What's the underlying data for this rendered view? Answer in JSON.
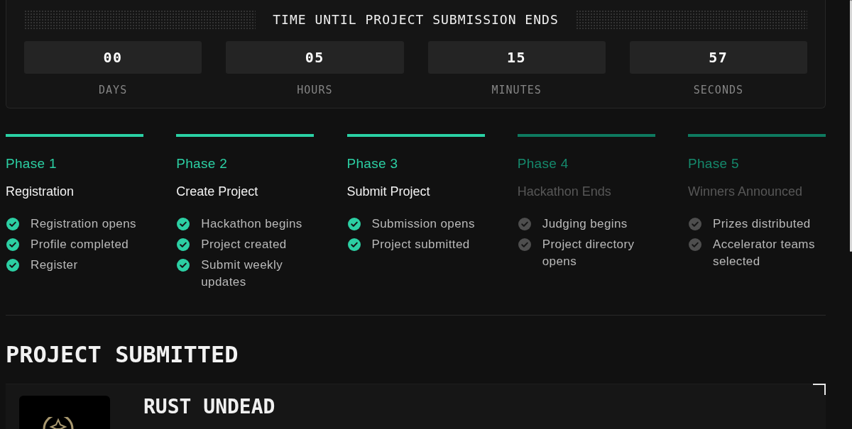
{
  "countdown": {
    "title": "TIME UNTIL PROJECT SUBMISSION ENDS",
    "units": [
      {
        "value": "00",
        "label": "DAYS"
      },
      {
        "value": "05",
        "label": "HOURS"
      },
      {
        "value": "15",
        "label": "MINUTES"
      },
      {
        "value": "57",
        "label": "SECONDS"
      }
    ]
  },
  "phases": [
    {
      "label": "Phase 1",
      "title": "Registration",
      "completed": true,
      "steps": [
        {
          "text": "Registration opens",
          "done": true
        },
        {
          "text": "Profile completed",
          "done": true
        },
        {
          "text": "Register",
          "done": true
        }
      ]
    },
    {
      "label": "Phase 2",
      "title": "Create Project",
      "completed": true,
      "steps": [
        {
          "text": "Hackathon begins",
          "done": true
        },
        {
          "text": "Project created",
          "done": true
        },
        {
          "text": "Submit weekly updates",
          "done": true
        }
      ]
    },
    {
      "label": "Phase 3",
      "title": "Submit Project",
      "completed": true,
      "steps": [
        {
          "text": "Submission opens",
          "done": true
        },
        {
          "text": "Project submitted",
          "done": true
        }
      ]
    },
    {
      "label": "Phase 4",
      "title": "Hackathon Ends",
      "completed": false,
      "steps": [
        {
          "text": "Judging begins",
          "done": false
        },
        {
          "text": "Project directory opens",
          "done": false
        }
      ]
    },
    {
      "label": "Phase 5",
      "title": "Winners Announced",
      "completed": false,
      "steps": [
        {
          "text": "Prizes distributed",
          "done": false
        },
        {
          "text": "Accelerator teams selected",
          "done": false
        }
      ]
    }
  ],
  "project_section": {
    "heading": "PROJECT SUBMITTED",
    "project": {
      "name": "RUST UNDEAD"
    }
  }
}
